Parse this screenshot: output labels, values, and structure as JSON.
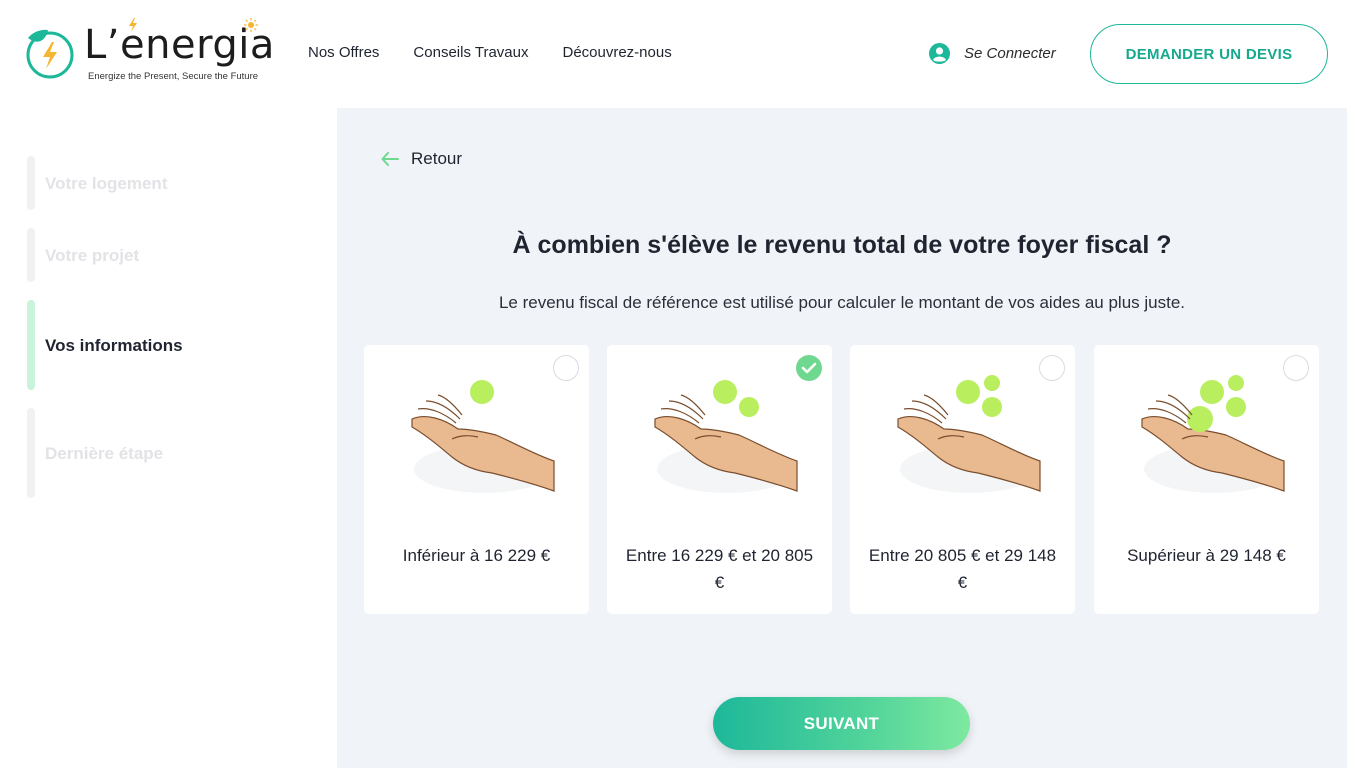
{
  "brand": {
    "name": "L’energia",
    "tagline": "Energize the Present, Secure the Future"
  },
  "nav": {
    "items": [
      "Nos Offres",
      "Conseils Travaux",
      "Découvrez-nous"
    ]
  },
  "account": {
    "connect_label": "Se Connecter"
  },
  "header": {
    "quote_button": "DEMANDER UN DEVIS"
  },
  "steps": [
    {
      "label": "Votre logement",
      "state": "inactive"
    },
    {
      "label": "Votre projet",
      "state": "inactive"
    },
    {
      "label": "Vos informations",
      "state": "active"
    },
    {
      "label": "Dernière étape",
      "state": "inactive"
    }
  ],
  "form": {
    "back_label": "Retour",
    "question": "À combien s'élève le revenu total de votre foyer fiscal ?",
    "subtext": "Le revenu fiscal de référence est utilisé pour calculer le montant de vos aides au plus juste.",
    "options": [
      {
        "label": "Inférieur à 16 229 €",
        "selected": false
      },
      {
        "label": "Entre 16 229 € et 20 805 €",
        "selected": true
      },
      {
        "label": "Entre 20 805 € et 29 148 €",
        "selected": false
      },
      {
        "label": "Supérieur à 29 148 €",
        "selected": false
      }
    ],
    "next_label": "SUIVANT"
  },
  "colors": {
    "accent": "#1db89a",
    "accent_light": "#7ee9a0",
    "coin": "#b9ee5e",
    "check": "#6fd88f",
    "panel_bg": "#f0f3f7"
  },
  "icons": {
    "logo": "lightning-leaf-logo-icon",
    "user": "user-circle-icon",
    "back": "arrow-left-icon",
    "check": "check-icon"
  }
}
